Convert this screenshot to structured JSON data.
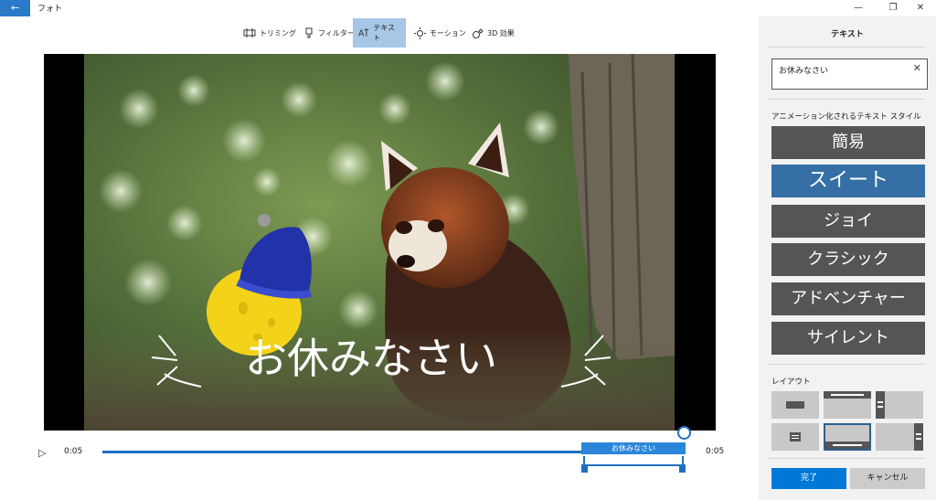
{
  "app": {
    "title": "フォト",
    "back_icon": "←"
  },
  "window_controls": {
    "minimize": "—",
    "restore": "❐",
    "close": "✕"
  },
  "toolbar": {
    "tools": [
      {
        "label": "トリミング",
        "icon": "trim-icon"
      },
      {
        "label": "フィルター",
        "icon": "filter-icon"
      },
      {
        "label": "テキスト",
        "icon": "text-icon",
        "active": true
      },
      {
        "label": "モーション",
        "icon": "motion-icon"
      },
      {
        "label": "3D 効果",
        "icon": "3d-effects-icon"
      }
    ]
  },
  "preview": {
    "overlay_text": "お休みなさい"
  },
  "timeline": {
    "play_icon": "▷",
    "start_time": "0:05",
    "end_time": "0:05",
    "clip_label": "お休みなさい"
  },
  "panel": {
    "title": "テキスト",
    "text_value": "お休みなさい",
    "clear_icon": "✕",
    "styles_label": "アニメーション化されるテキスト スタイル",
    "styles": [
      {
        "label": "簡易"
      },
      {
        "label": "スイート",
        "selected": true
      },
      {
        "label": "ジョイ"
      },
      {
        "label": "クラシック"
      },
      {
        "label": "アドベンチャー"
      },
      {
        "label": "サイレント"
      }
    ],
    "layout_label": "レイアウト",
    "done": "完了",
    "cancel": "キャンセル"
  },
  "colors": {
    "accent": "#0078d7",
    "selected_style": "#356fa5",
    "style_button": "#555555"
  }
}
